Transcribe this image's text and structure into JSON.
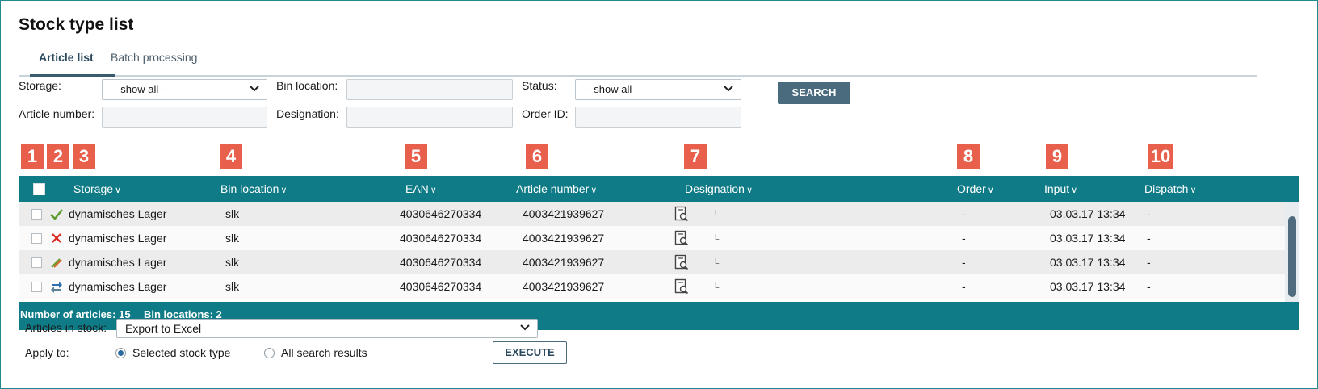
{
  "page": {
    "title": "Stock type list",
    "tabs": [
      {
        "label": "Article list",
        "active": true
      },
      {
        "label": "Batch processing",
        "active": false
      }
    ]
  },
  "filters": {
    "storage_label": "Storage:",
    "storage_value": "-- show all --",
    "bin_location_label": "Bin location:",
    "bin_location_value": "",
    "status_label": "Status:",
    "status_value": "-- show all --",
    "search_button": "SEARCH",
    "article_number_label": "Article number:",
    "article_number_value": "",
    "designation_label": "Designation:",
    "designation_value": "",
    "order_id_label": "Order ID:",
    "order_id_value": ""
  },
  "markers": [
    "1",
    "2",
    "3",
    "4",
    "5",
    "6",
    "7",
    "8",
    "9",
    "10"
  ],
  "grid": {
    "columns": [
      "Storage",
      "Bin location",
      "EAN",
      "Article number",
      "Designation",
      "Order",
      "Input",
      "Dispatch"
    ],
    "rows": [
      {
        "status_icon": "checkmark-icon",
        "storage": "dynamisches Lager",
        "bin": "slk",
        "ean": "4030646270334",
        "article": "4003421939627",
        "designation_small": "L",
        "order": "-",
        "input": "03.03.17 13:34",
        "dispatch": "-"
      },
      {
        "status_icon": "cross-icon",
        "storage": "dynamisches Lager",
        "bin": "slk",
        "ean": "4030646270334",
        "article": "4003421939627",
        "designation_small": "L",
        "order": "-",
        "input": "03.03.17 13:34",
        "dispatch": "-"
      },
      {
        "status_icon": "pencil-icon",
        "storage": "dynamisches Lager",
        "bin": "slk",
        "ean": "4030646270334",
        "article": "4003421939627",
        "designation_small": "L",
        "order": "-",
        "input": "03.03.17 13:34",
        "dispatch": "-"
      },
      {
        "status_icon": "transfer-arrows-icon",
        "storage": "dynamisches Lager",
        "bin": "slk",
        "ean": "4030646270334",
        "article": "4003421939627",
        "designation_small": "L",
        "order": "-",
        "input": "03.03.17 13:34",
        "dispatch": "-"
      }
    ],
    "footer": {
      "articles": "Number of articles: 15",
      "bins": "Bin locations: 2"
    }
  },
  "actions": {
    "articles_in_stock_label": "Articles in stock:",
    "articles_in_stock_value": "Export to Excel",
    "apply_to_label": "Apply to:",
    "option_selected": "Selected stock type",
    "option_all": "All search results",
    "execute_button": "EXECUTE"
  },
  "colors": {
    "teal_header": "#0e7b86",
    "marker_red": "#e8604c",
    "button_slate": "#4a6a7e"
  }
}
